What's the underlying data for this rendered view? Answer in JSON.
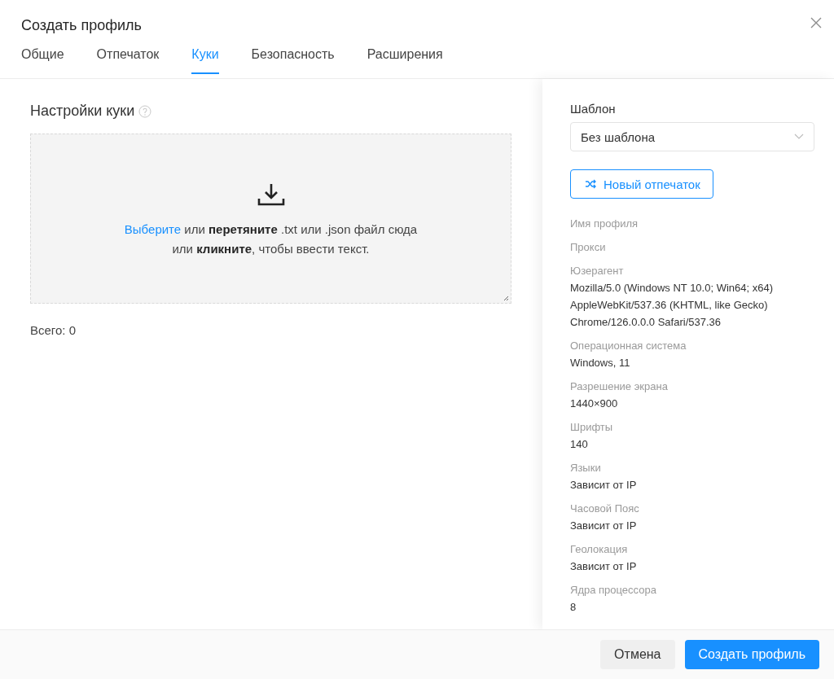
{
  "dialog": {
    "title": "Создать профиль"
  },
  "tabs": [
    {
      "label": "Общие",
      "selected": false
    },
    {
      "label": "Отпечаток",
      "selected": false
    },
    {
      "label": "Куки",
      "selected": true
    },
    {
      "label": "Безопасность",
      "selected": false
    },
    {
      "label": "Расширения",
      "selected": false
    }
  ],
  "cookies": {
    "heading": "Настройки куки",
    "dropzone_link": "Выберите",
    "dropzone_text": " или **перетяните** .txt или .json файл сюда\nили **кликните**, чтобы ввести текст.",
    "total": "Всего: 0"
  },
  "sidebar": {
    "template_label": "Шаблон",
    "template_value": "Без шаблона",
    "new_fingerprint_button": "Новый отпечаток",
    "fields": [
      {
        "label": "Имя профиля"
      },
      {
        "label": "Прокси"
      },
      {
        "label": "Юзерагент",
        "value": "Mozilla/5.0 (Windows NT 10.0; Win64; x64) AppleWebKit/537.36 (KHTML, like Gecko) Chrome/126.0.0.0 Safari/537.36"
      },
      {
        "label": "Операционная система",
        "value": "Windows, 11"
      },
      {
        "label": "Разрешение экрана",
        "value": "1440×900"
      },
      {
        "label": "Шрифты",
        "value": "140"
      },
      {
        "label": "Языки",
        "value": "Зависит от IP"
      },
      {
        "label": "Часовой Пояс",
        "value": "Зависит от IP"
      },
      {
        "label": "Геолокация",
        "value": "Зависит от IP"
      },
      {
        "label": "Ядра процессора",
        "value": "8"
      }
    ]
  },
  "buttons": [
    {
      "label": "Отмена",
      "kind": "secondary"
    },
    {
      "label": "Создать профиль",
      "kind": "primary"
    }
  ]
}
